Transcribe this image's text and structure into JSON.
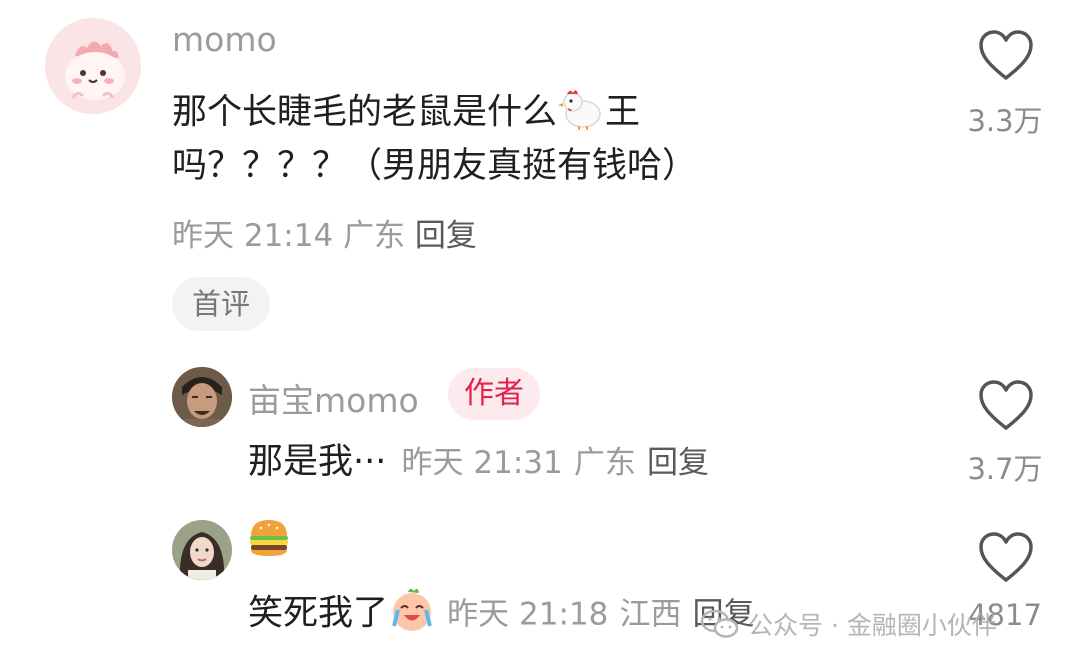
{
  "comment": {
    "username": "momo",
    "text_line1": "那个长睫毛的老鼠是什么",
    "text_line1_tail": "王",
    "text_line2": "吗？？？？（男朋友真挺有钱哈）",
    "time": "昨天 21:14",
    "location": "广东",
    "reply_label": "回复",
    "badge": "首评",
    "likes": "3.3万"
  },
  "replies": [
    {
      "username": "亩宝momo",
      "badge": "作者",
      "text": "那是我···",
      "time": "昨天 21:31",
      "location": "广东",
      "reply_label": "回复",
      "likes": "3.7万"
    },
    {
      "username": "",
      "text": "笑死我了",
      "time": "昨天 21:18",
      "location": "江西",
      "reply_label": "回复",
      "likes": "4817"
    }
  ],
  "watermark": {
    "text": "公众号 · 金融圈小伙伴"
  },
  "icons": {
    "like": "heart-outline-icon",
    "chicken": "chicken-emoji-icon",
    "burger": "burger-emoji-icon",
    "laughing": "laughing-cry-emoji-icon",
    "wechat": "wechat-icon"
  },
  "colors": {
    "author_badge_text": "#e0244b",
    "author_badge_bg": "#fdeaee",
    "meta_gray": "#9b9b9b"
  }
}
